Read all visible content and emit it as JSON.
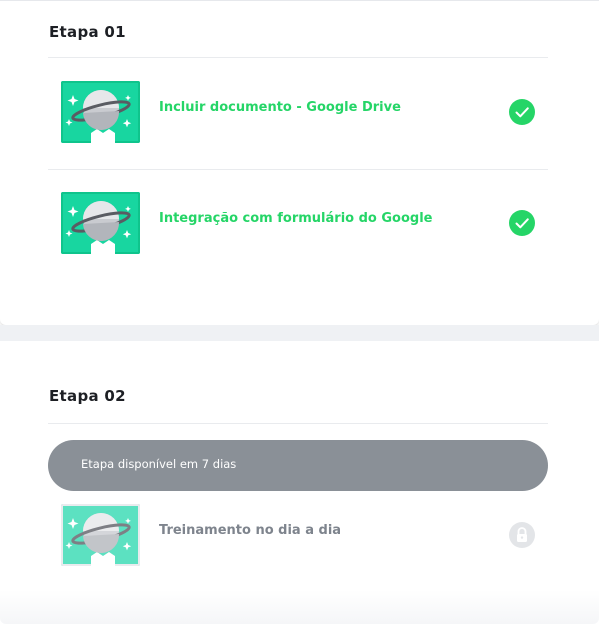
{
  "stages": [
    {
      "title": "Etapa 01",
      "lessons": [
        {
          "title": "Incluir documento - Google Drive",
          "status": "completed",
          "status_icon": "check-icon",
          "thumbnail_icon": "planet-icon"
        },
        {
          "title": "Integração com formulário do Google",
          "status": "completed",
          "status_icon": "check-icon",
          "thumbnail_icon": "planet-icon"
        }
      ]
    },
    {
      "title": "Etapa 02",
      "availability_banner": "Etapa disponível em 7 dias",
      "lessons": [
        {
          "title": "Treinamento no dia a dia",
          "status": "locked",
          "status_icon": "lock-icon",
          "thumbnail_icon": "planet-icon"
        }
      ]
    }
  ],
  "colors": {
    "accent_green": "#25d567",
    "thumbnail_bg": "#18d6a0",
    "locked_text": "#7e848d",
    "banner_bg": "#8a9097"
  }
}
